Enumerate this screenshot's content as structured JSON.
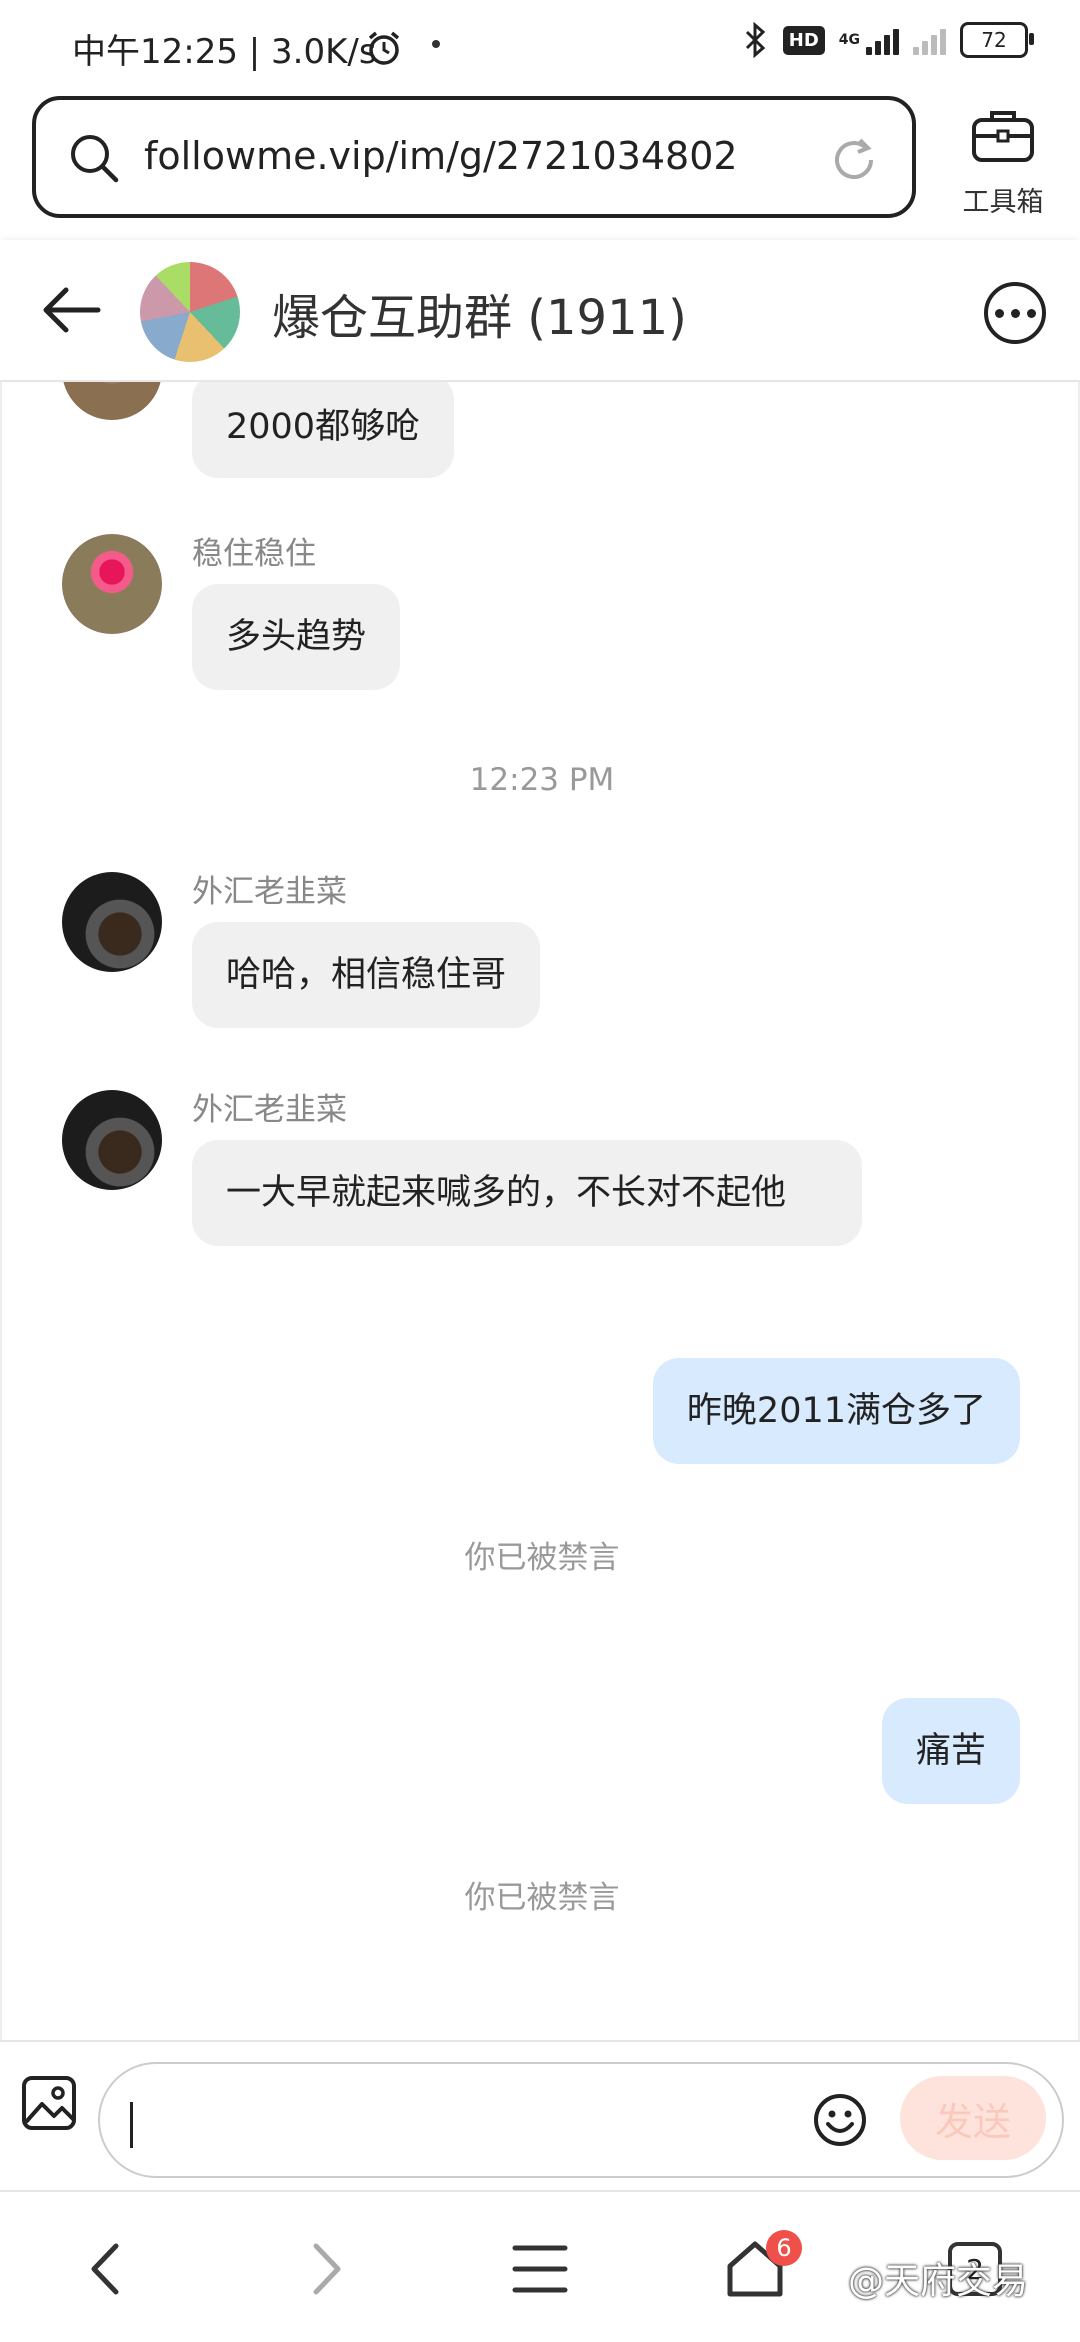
{
  "status_bar": {
    "time_speed": "中午12:25 | 3.0K/s",
    "hd_badge": "HD",
    "network_label": "4G",
    "battery": "72"
  },
  "browser": {
    "url": "followme.vip/im/g/2721034802",
    "tools_label": "工具箱"
  },
  "chat": {
    "title": "爆仓互助群 (1911)"
  },
  "messages": [
    {
      "type": "received",
      "sender": "",
      "text": "2000都够呛"
    },
    {
      "type": "received",
      "sender": "稳住稳住",
      "text": "多头趋势"
    },
    {
      "type": "time",
      "text": "12:23 PM"
    },
    {
      "type": "received",
      "sender": "外汇老韭菜",
      "text": "哈哈，相信稳住哥"
    },
    {
      "type": "received",
      "sender": "外汇老韭菜",
      "text": "一大早就起来喊多的，不长对不起他"
    },
    {
      "type": "sent",
      "text": "昨晚2011满仓多了"
    },
    {
      "type": "notice",
      "text": "你已被禁言"
    },
    {
      "type": "sent",
      "text": "痛苦"
    },
    {
      "type": "notice",
      "text": "你已被禁言"
    }
  ],
  "composer": {
    "input_value": "",
    "send_label": "发送"
  },
  "navbar": {
    "home_badge": "6",
    "tabs_count": "2",
    "watermark": "@天府交易"
  },
  "icons": {
    "search": "search-icon",
    "reload": "reload-icon",
    "toolbox": "toolbox-icon",
    "back": "back-arrow-icon",
    "more": "more-icon",
    "image": "image-icon",
    "emoji": "emoji-icon",
    "nav_back": "chevron-left-icon",
    "nav_forward": "chevron-right-icon",
    "menu": "menu-icon",
    "home": "home-icon",
    "tabs": "tabs-icon"
  },
  "colors": {
    "sent_bubble": "#d8eafd",
    "received_bubble": "#f0f0f0",
    "send_button": "#fde3dc",
    "badge": "#f0504a"
  }
}
